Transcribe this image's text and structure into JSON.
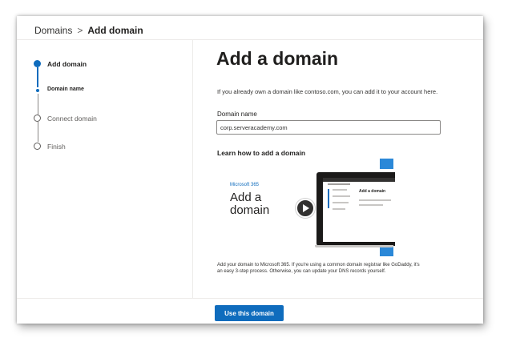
{
  "breadcrumb": {
    "parent": "Domains",
    "separator": ">",
    "current": "Add domain"
  },
  "steps": [
    {
      "label": "Add domain",
      "state": "current"
    },
    {
      "label": "Domain name",
      "state": "sub-current"
    },
    {
      "label": "Connect domain",
      "state": "pending"
    },
    {
      "label": "Finish",
      "state": "pending"
    }
  ],
  "main": {
    "title": "Add a domain",
    "intro": "If you already own a domain like contoso.com, you can add it to your account here.",
    "field_label": "Domain name",
    "field_value": "corp.serveracademy.com",
    "learn_heading": "Learn how to add a domain",
    "video": {
      "brand": "Microsoft 365",
      "title_line1": "Add a",
      "title_line2": "domain",
      "screen_title": "Add a domain"
    },
    "description": "Add your domain to Microsoft 365. If you're using a common domain registrar like GoDaddy, it's an easy 3-step process. Otherwise, you can update your DNS records yourself."
  },
  "footer": {
    "primary_button": "Use this domain"
  },
  "colors": {
    "accent": "#0f6cbd",
    "text": "#323130",
    "divider": "#edebe9"
  },
  "icons": [
    "play-icon",
    "step-complete-dot",
    "step-pending-circle"
  ]
}
